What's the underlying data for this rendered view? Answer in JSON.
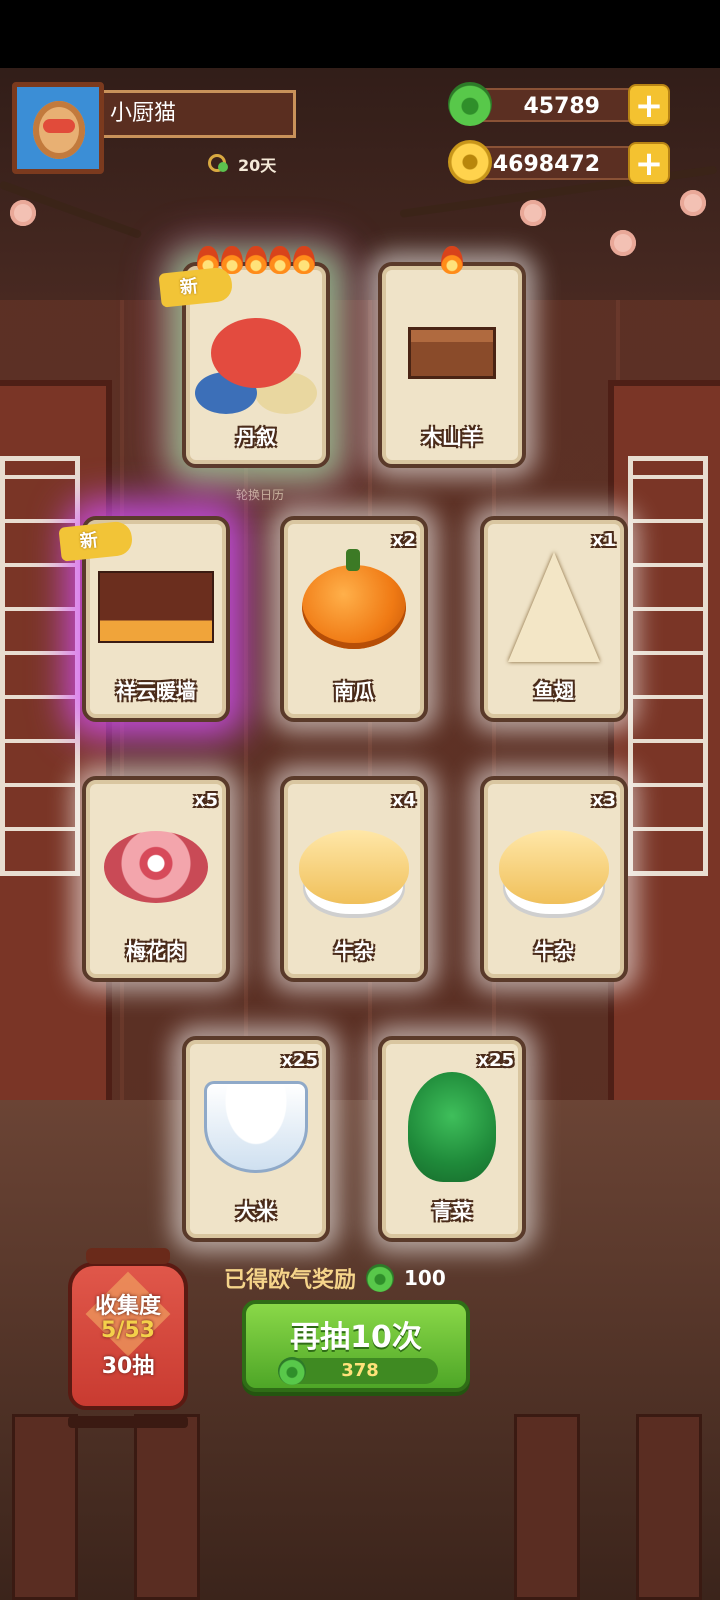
{
  "player": {
    "name": "小厨猫",
    "days": "20天"
  },
  "currency": {
    "jade": "45789",
    "gold": "4698472"
  },
  "subtitle": "轮换日历",
  "new_tag": "新",
  "cards": [
    {
      "name": "丹叙",
      "count": "",
      "is_new": true,
      "flames": 5,
      "art": "dragon-art"
    },
    {
      "name": "木山羊",
      "count": "",
      "is_new": false,
      "flames": 1,
      "art": "wood-block-art"
    },
    {
      "name": "祥云暖墙",
      "count": "",
      "is_new": true,
      "flames": 0,
      "art": "wall-art"
    },
    {
      "name": "南瓜",
      "count": "x2",
      "is_new": false,
      "flames": 0,
      "art": "pumpkin-art"
    },
    {
      "name": "鱼翅",
      "count": "x1",
      "is_new": false,
      "flames": 0,
      "art": "shark-fin-art"
    },
    {
      "name": "梅花肉",
      "count": "x5",
      "is_new": false,
      "flames": 0,
      "art": "pork-art"
    },
    {
      "name": "牛杂",
      "count": "x4",
      "is_new": false,
      "flames": 0,
      "art": "beef-offal-art"
    },
    {
      "name": "牛杂",
      "count": "x3",
      "is_new": false,
      "flames": 0,
      "art": "beef-offal-art"
    },
    {
      "name": "大米",
      "count": "x25",
      "is_new": false,
      "flames": 0,
      "art": "rice-art"
    },
    {
      "name": "青菜",
      "count": "x25",
      "is_new": false,
      "flames": 0,
      "art": "greens-art"
    }
  ],
  "reward": {
    "label": "已得欧气奖励",
    "value": "100"
  },
  "draw_button": {
    "label": "再抽10次",
    "cost": "378"
  },
  "collection": {
    "title": "收集度",
    "progress": "5/53",
    "draws": "30抽"
  }
}
